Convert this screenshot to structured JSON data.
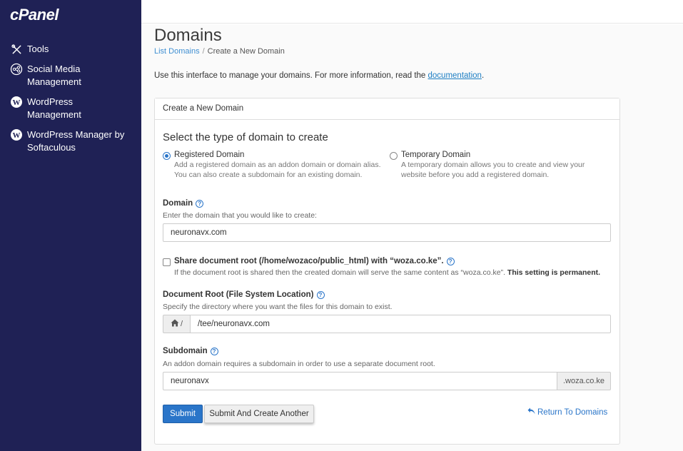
{
  "sidebar": {
    "logo": "cPanel",
    "items": [
      {
        "label_line1": "Tools",
        "label_line2": "",
        "icon": "tools-icon"
      },
      {
        "label_line1": "Social Media",
        "label_line2": "Management",
        "icon": "social-media-icon"
      },
      {
        "label_line1": "WordPress",
        "label_line2": "Management",
        "icon": "wordpress-icon"
      },
      {
        "label_line1": "WordPress Manager by",
        "label_line2": "Softaculous",
        "icon": "wordpress-icon"
      }
    ]
  },
  "header": {
    "title": "Domains",
    "breadcrumb": {
      "link": "List Domains",
      "separator": "/",
      "current": "Create a New Domain"
    },
    "intro_text": "Use this interface to manage your domains. For more information, read the ",
    "intro_link": "documentation",
    "intro_end": "."
  },
  "panel": {
    "heading": "Create a New Domain",
    "section_title": "Select the type of domain to create",
    "radio_registered": {
      "label": "Registered Domain",
      "desc_line1": "Add a registered domain as an addon domain or domain alias.",
      "desc_line2": "You can also create a subdomain for an existing domain.",
      "checked": true
    },
    "radio_temporary": {
      "label": "Temporary Domain",
      "desc_line1": "A temporary domain allows you to create and view your",
      "desc_line2": "website before you add a registered domain.",
      "checked": false
    },
    "domain": {
      "label": "Domain",
      "help": "Enter the domain that you would like to create:",
      "value": "neuronavx.com"
    },
    "share_root": {
      "label": "Share document root (/home/wozaco/public_html) with “woza.co.ke”.",
      "desc": "If the document root is shared then the created domain will serve the same content as “woza.co.ke”. ",
      "desc_bold": "This setting is permanent.",
      "checked": false
    },
    "document_root": {
      "label": "Document Root (File System Location)",
      "help": "Specify the directory where you want the files for this domain to exist.",
      "prefix": "/",
      "value": "/tee/neuronavx.com"
    },
    "subdomain": {
      "label": "Subdomain",
      "help": "An addon domain requires a subdomain in order to use a separate document root.",
      "value": "neuronavx",
      "suffix": ".woza.co.ke"
    },
    "buttons": {
      "submit": "Submit",
      "submit_another": "Submit And Create Another",
      "return": "Return To Domains"
    }
  },
  "colors": {
    "sidebar_bg": "#1f2155",
    "primary": "#2a75c9",
    "link": "#3f8fd2"
  }
}
